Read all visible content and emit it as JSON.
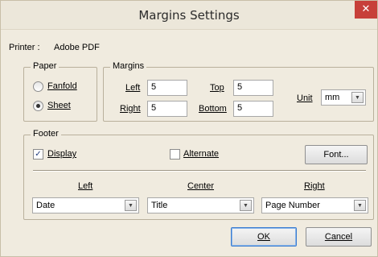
{
  "window": {
    "title": "Margins Settings",
    "close_glyph": "✕"
  },
  "printer": {
    "label": "Printer :",
    "value": "Adobe PDF"
  },
  "paper": {
    "legend": "Paper",
    "options": [
      {
        "label": "Fanfold",
        "selected": false
      },
      {
        "label": "Sheet",
        "selected": true
      }
    ]
  },
  "margins": {
    "legend": "Margins",
    "left_label": "Left",
    "left_value": "5",
    "top_label": "Top",
    "top_value": "5",
    "right_label": "Right",
    "right_value": "5",
    "bottom_label": "Bottom",
    "bottom_value": "5",
    "unit_label": "Unit",
    "unit_value": "mm"
  },
  "footer": {
    "legend": "Footer",
    "display_label": "Display",
    "display_checked": true,
    "alternate_label": "Alternate",
    "alternate_checked": false,
    "font_button": "Font...",
    "left_header": "Left",
    "center_header": "Center",
    "right_header": "Right",
    "left_value": "Date",
    "center_value": "Title",
    "right_value": "Page Number"
  },
  "buttons": {
    "ok": "OK",
    "cancel": "Cancel"
  },
  "icons": {
    "radio": "radio-icon",
    "check": "checkbox-icon",
    "dropdown": "chevron-down-icon"
  }
}
